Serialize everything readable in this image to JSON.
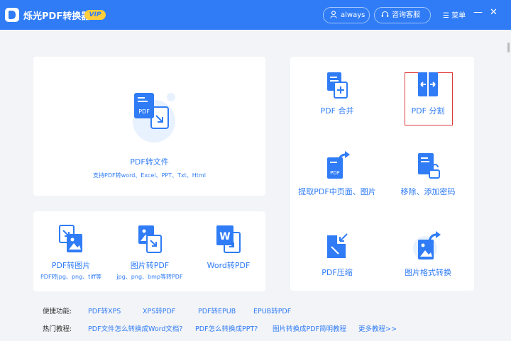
{
  "app": {
    "title": "烁光PDF转换器",
    "badge": "VIP"
  },
  "header": {
    "user_label": "always",
    "service_label": "咨询客服",
    "menu_label": "菜单",
    "minimize_glyph": "—",
    "close_glyph": "✕"
  },
  "convert_card": {
    "name": "PDF转文件",
    "desc": "支持PDF转word、Excel、PPT、Txt、Html"
  },
  "tools": [
    {
      "name": "PDF转图片",
      "desc": "PDF转jpg、png、tiff等"
    },
    {
      "name": "图片转PDF",
      "desc": "jpg、png、bmp等转PDF"
    },
    {
      "name": "Word转PDF",
      "desc": ""
    }
  ],
  "right_tools": [
    {
      "name": "PDF 合并"
    },
    {
      "name": "PDF 分割"
    },
    {
      "name": "提取PDF中页面、图片"
    },
    {
      "name": "移除、添加密码"
    },
    {
      "name": "PDF压缩"
    },
    {
      "name": "图片格式转换"
    }
  ],
  "shortcuts": {
    "label": "便捷功能:",
    "links": [
      "PDF转XPS",
      "XPS转PDF",
      "PDF转EPUB",
      "EPUB转PDF"
    ]
  },
  "tutorials": {
    "label": "热门教程:",
    "links": [
      "PDF文件怎么转换成Word文档?",
      "PDF怎么转换成PPT?",
      "图片转换成PDF简明教程",
      "更多教程>>"
    ]
  },
  "colors": {
    "primary": "#2f7cf6",
    "vip": "#ffce3a",
    "highlight_border": "#e03a3a"
  }
}
